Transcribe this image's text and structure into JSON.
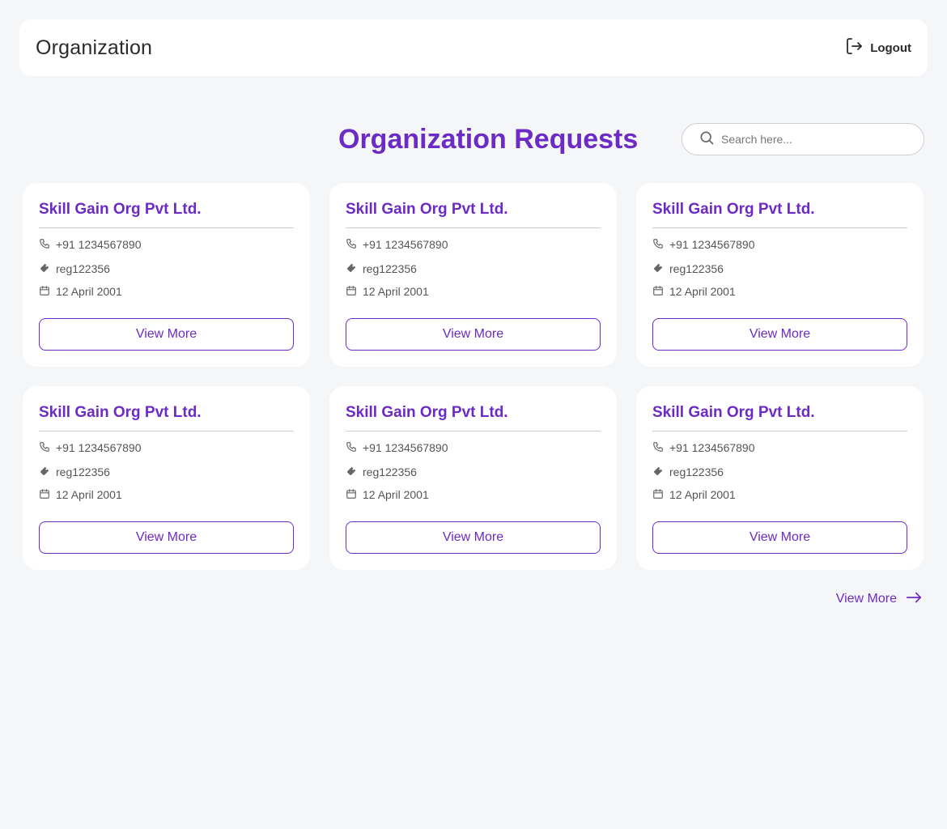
{
  "header": {
    "title": "Organization",
    "logout_label": "Logout",
    "logout_icon": "logout-icon"
  },
  "main": {
    "title": "Organization Requests",
    "search": {
      "placeholder": "Search here...",
      "value": ""
    }
  },
  "cards": [
    {
      "name": "Skill Gain Org Pvt Ltd.",
      "phone": "+91 1234567890",
      "reg": "reg122356",
      "date": "12 April 2001",
      "button": "View More"
    },
    {
      "name": "Skill Gain Org Pvt Ltd.",
      "phone": "+91 1234567890",
      "reg": "reg122356",
      "date": "12 April 2001",
      "button": "View More"
    },
    {
      "name": "Skill Gain Org Pvt Ltd.",
      "phone": "+91 1234567890",
      "reg": "reg122356",
      "date": "12 April 2001",
      "button": "View More"
    },
    {
      "name": "Skill Gain Org Pvt Ltd.",
      "phone": "+91 1234567890",
      "reg": "reg122356",
      "date": "12 April 2001",
      "button": "View More"
    },
    {
      "name": "Skill Gain Org Pvt Ltd.",
      "phone": "+91 1234567890",
      "reg": "reg122356",
      "date": "12 April 2001",
      "button": "View More"
    },
    {
      "name": "Skill Gain Org Pvt Ltd.",
      "phone": "+91 1234567890",
      "reg": "reg122356",
      "date": "12 April 2001",
      "button": "View More"
    }
  ],
  "footer_link": {
    "label": "View More",
    "icon": "arrow-right-icon"
  },
  "colors": {
    "accent": "#6c2bc4",
    "background": "#f5f6f8",
    "card": "#ffffff",
    "text": "#555555"
  }
}
